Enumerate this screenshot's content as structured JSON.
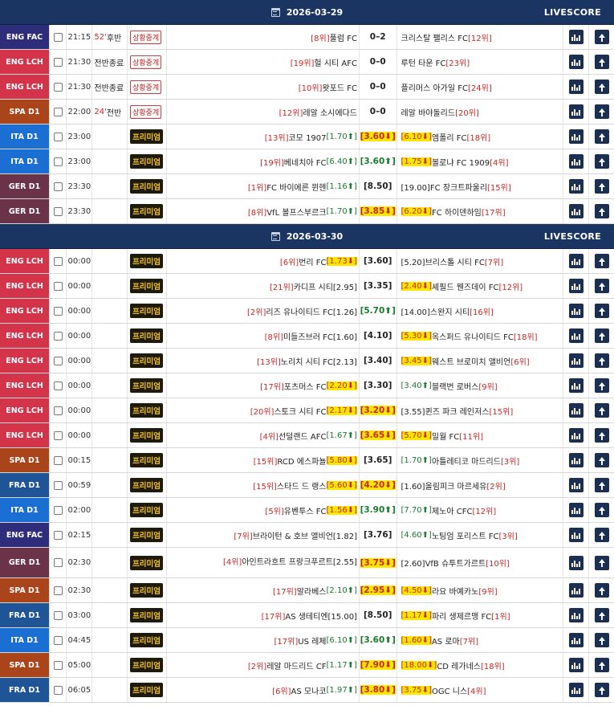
{
  "livescore_label": "LIVESCORE",
  "colors": {
    "ENG FAC": "#2d2d7b",
    "ENG LCH": "#d3344a",
    "SPA D1": "#a9441b",
    "ITA D1": "#1b6fd3",
    "GER D1": "#6b3348",
    "FRA D1": "#1f5597",
    "header": "#1a3561"
  },
  "days": [
    {
      "date": "2026-03-29",
      "matches": [
        {
          "league": "ENG FAC",
          "time": "21:15",
          "status": "52' 후반",
          "btn": "상황중계",
          "home": "[8위]풀럼 FC",
          "score": "0–2",
          "away": "크리스탈 팰리스 FC[12위]"
        },
        {
          "league": "ENG LCH",
          "time": "21:30",
          "status": "전반종료",
          "btn": "상황중계",
          "home": "[19위]헐 시티 AFC",
          "score": "0–0",
          "away": "루턴 타운 FC[23위]"
        },
        {
          "league": "ENG LCH",
          "time": "21:30",
          "status": "전반종료",
          "btn": "상황중계",
          "home": "[10위]왓포드 FC",
          "score": "0–0",
          "away": "플리머스 아가일 FC[24위]"
        },
        {
          "league": "SPA D1",
          "time": "22:00",
          "status": "24' 전반",
          "btn": "상황중계",
          "home": "[12위]레알 소시에다드",
          "score": "0–0",
          "away": "레알 바야돌리드[20위]"
        },
        {
          "league": "ITA D1",
          "time": "23:00",
          "status": "",
          "btn": "프리미엄",
          "home": "[13위]코모 1907[1.70↑]",
          "score": "[3.60↓]",
          "away": "[6.10↓]엠폴리 FC[18위]"
        },
        {
          "league": "ITA D1",
          "time": "23:00",
          "status": "",
          "btn": "프리미엄",
          "home": "[19위]베네치아 FC[6.40↑]",
          "score": "[3.60↑]",
          "away": "[1.75↓]볼로냐 FC 1909[4위]"
        },
        {
          "league": "GER D1",
          "time": "23:30",
          "status": "",
          "btn": "프리미엄",
          "home": "[1위]FC 바이에른 뮌헨[1.16↑]",
          "score": "[8.50]",
          "away": "[19.00]FC 장크트파울리[15위]"
        },
        {
          "league": "GER D1",
          "time": "23:30",
          "status": "",
          "btn": "프리미엄",
          "home": "[8위]VfL 볼프스부르크[1.70↑]",
          "score": "[3.85↓]",
          "away": "[6.20↓]FC 하이덴하임[17위]"
        }
      ]
    },
    {
      "date": "2026-03-30",
      "matches": [
        {
          "league": "ENG LCH",
          "time": "00:00",
          "status": "",
          "btn": "프리미엄",
          "home": "[6위]번리 FC[1.73↓]",
          "score": "[3.60]",
          "away": "[5.20]브리스톨 시티 FC[7위]"
        },
        {
          "league": "ENG LCH",
          "time": "00:00",
          "status": "",
          "btn": "프리미엄",
          "home": "[21위]카디프 시티[2.95]",
          "score": "[3.35]",
          "away": "[2.40↓]셰필드 웬즈데이 FC[12위]"
        },
        {
          "league": "ENG LCH",
          "time": "00:00",
          "status": "",
          "btn": "프리미엄",
          "home": "[2위]리즈 유나이티드 FC[1.26]",
          "score": "[5.70↑]",
          "away": "[14.00]스완지 시티[16위]"
        },
        {
          "league": "ENG LCH",
          "time": "00:00",
          "status": "",
          "btn": "프리미엄",
          "home": "[8위]미들즈브러 FC[1.60]",
          "score": "[4.10]",
          "away": "[5.30↓]옥스퍼드 유나이티드 FC[18위]"
        },
        {
          "league": "ENG LCH",
          "time": "00:00",
          "status": "",
          "btn": "프리미엄",
          "home": "[13위]노리치 시티 FC[2.13]",
          "score": "[3.40]",
          "away": "[3.45↓]웨스트 브로미치 앨비언[6위]"
        },
        {
          "league": "ENG LCH",
          "time": "00:00",
          "status": "",
          "btn": "프리미엄",
          "home": "[17위]포츠머스 FC[2.20↓]",
          "score": "[3.30]",
          "away": "[3.40↑]블랙번 로버스[9위]"
        },
        {
          "league": "ENG LCH",
          "time": "00:00",
          "status": "",
          "btn": "프리미엄",
          "home": "[20위]스토크 시티 FC[2.17↓]",
          "score": "[3.20↓]",
          "away": "[3.55]퀸즈 파크 레인저스[15위]"
        },
        {
          "league": "ENG LCH",
          "time": "00:00",
          "status": "",
          "btn": "프리미엄",
          "home": "[4위]선덜랜드 AFC[1.67↑]",
          "score": "[3.65↓]",
          "away": "[5.70↓]밀월 FC[11위]"
        },
        {
          "league": "SPA D1",
          "time": "00:15",
          "status": "",
          "btn": "프리미엄",
          "home": "[15위]RCD 에스파뇰[5.80↓]",
          "score": "[3.65]",
          "away": "[1.70↑]아틀레티코 마드리드[3위]"
        },
        {
          "league": "FRA D1",
          "time": "00:59",
          "status": "",
          "btn": "프리미엄",
          "home": "[15위]스타드 드 랭스[5.60↓]",
          "score": "[4.20↓]",
          "away": "[1.60]올림피크 마르세유[2위]"
        },
        {
          "league": "ITA D1",
          "time": "02:00",
          "status": "",
          "btn": "프리미엄",
          "home": "[5위]유벤투스 FC[1.56↓]",
          "score": "[3.90↑]",
          "away": "[7.70↑]제노아 CFC[12위]"
        },
        {
          "league": "ENG FAC",
          "time": "02:15",
          "status": "",
          "btn": "프리미엄",
          "home": "[7위]브라이턴 & 호브 앨비언[1.82]",
          "score": "[3.76]",
          "away": "[4.60↑]노팅엄 포리스트 FC[3위]"
        },
        {
          "league": "GER D1",
          "time": "02:30",
          "status": "",
          "btn": "프리미엄",
          "home": "[4위]아인트라흐트 프랑크푸르트[2.55]",
          "score": "[3.75↓]",
          "away": "[2.60]VfB 슈투트가르트[10위]",
          "tall": true
        },
        {
          "league": "SPA D1",
          "time": "02:30",
          "status": "",
          "btn": "프리미엄",
          "home": "[17위]알라베스[2.10↑]",
          "score": "[2.95↓]",
          "away": "[4.50↓]라요 바예카노[9위]"
        },
        {
          "league": "FRA D1",
          "time": "03:00",
          "status": "",
          "btn": "프리미엄",
          "home": "[17위]AS 생테티엔[15.00]",
          "score": "[8.50]",
          "away": "[1.17↓]파리 생제르맹 FC[1위]"
        },
        {
          "league": "ITA D1",
          "time": "04:45",
          "status": "",
          "btn": "프리미엄",
          "home": "[17위]US 레체[6.10↑]",
          "score": "[3.60↑]",
          "away": "[1.60↓]AS 로마[7위]"
        },
        {
          "league": "SPA D1",
          "time": "05:00",
          "status": "",
          "btn": "프리미엄",
          "home": "[2위]레알 마드리드 CF[1.17↑]",
          "score": "[7.90↓]",
          "away": "[18.00↓]CD 레가네스[18위]"
        },
        {
          "league": "FRA D1",
          "time": "06:05",
          "status": "",
          "btn": "프리미엄",
          "home": "[6위]AS 모나코[1.97↑]",
          "score": "[3.80↓]",
          "away": "[3.75↓]OGC 니스[4위]"
        }
      ]
    }
  ]
}
